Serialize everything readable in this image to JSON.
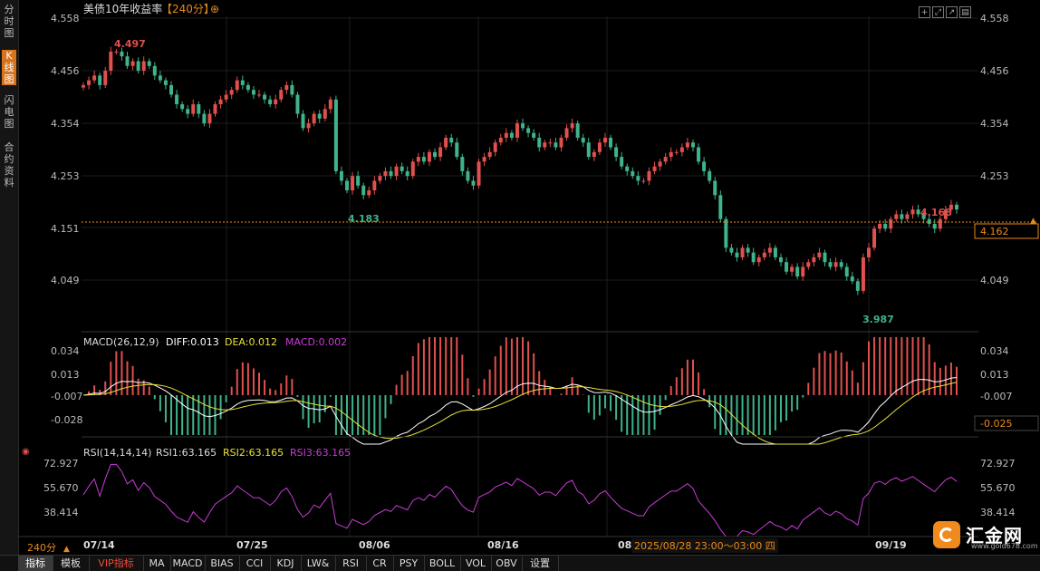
{
  "sidebar": {
    "tabs": [
      {
        "label": "分时图",
        "active": false
      },
      {
        "label": "K线图",
        "active": true
      },
      {
        "label": "闪电图",
        "active": false
      },
      {
        "label": "合约资料",
        "active": false
      }
    ]
  },
  "header": {
    "title": "美债10年收益率",
    "period": "【240分】",
    "add_icon": "circle-plus-icon",
    "tools": [
      "crosshair-icon",
      "expand-icon",
      "export-icon",
      "settings-icon"
    ]
  },
  "price_axis": {
    "labels": [
      "4.558",
      "4.456",
      "4.354",
      "4.253",
      "4.151",
      "4.049"
    ],
    "current_value": "4.162"
  },
  "annotations": {
    "high": "4.497",
    "low1": "4.183",
    "low2": "3.987",
    "recent_high": "4.168"
  },
  "macd": {
    "title": "MACD(26,12,9)",
    "diff": "DIFF:0.013",
    "dea": "DEA:0.012",
    "macd": "MACD:0.002",
    "axis_labels": [
      "0.034",
      "0.013",
      "-0.007",
      "-0.028"
    ],
    "current_value": "-0.025"
  },
  "rsi": {
    "title": "RSI(14,14,14)",
    "rsi1": "RSI1:63.165",
    "rsi2": "RSI2:63.165",
    "rsi3": "RSI3:63.165",
    "axis_labels": [
      "72.927",
      "55.670",
      "38.414"
    ]
  },
  "time_axis": {
    "period_label": "240分",
    "dates": [
      "07/14",
      "07/25",
      "08/06",
      "08/16",
      "08",
      "09/19"
    ],
    "crosshair_time": "2025/08/28 23:00～03:00 四"
  },
  "bottom_tabs": [
    "指标",
    "模板",
    "VIP指标",
    "MA",
    "MACD",
    "BIAS",
    "CCI",
    "KDJ",
    "LW&",
    "RSI",
    "CR",
    "PSY",
    "BOLL",
    "VOL",
    "OBV",
    "设置"
  ],
  "logo": {
    "text": "汇金网",
    "url": "www.gold678.com"
  },
  "colors": {
    "up": "#e0504d",
    "down": "#3fb389",
    "diff": "#ffffff",
    "dea": "#e8e13a",
    "rsi": "#c83cd6",
    "dashed": "#e88a1a",
    "accent": "#d8731c"
  },
  "chart_data": {
    "type": "candlestick",
    "title": "美债10年收益率",
    "ylim": [
      3.95,
      4.56
    ],
    "series": [
      {
        "name": "price",
        "values": [
          4.42,
          4.43,
          4.44,
          4.42,
          4.45,
          4.49,
          4.49,
          4.48,
          4.46,
          4.47,
          4.45,
          4.47,
          4.46,
          4.44,
          4.43,
          4.42,
          4.4,
          4.38,
          4.37,
          4.36,
          4.38,
          4.36,
          4.34,
          4.36,
          4.38,
          4.39,
          4.4,
          4.41,
          4.43,
          4.42,
          4.41,
          4.4,
          4.4,
          4.39,
          4.38,
          4.39,
          4.41,
          4.42,
          4.4,
          4.36,
          4.33,
          4.34,
          4.36,
          4.35,
          4.37,
          4.39,
          4.24,
          4.22,
          4.2,
          4.23,
          4.21,
          4.19,
          4.2,
          4.22,
          4.23,
          4.24,
          4.23,
          4.25,
          4.24,
          4.23,
          4.26,
          4.27,
          4.26,
          4.28,
          4.27,
          4.29,
          4.31,
          4.3,
          4.27,
          4.24,
          4.22,
          4.21,
          4.26,
          4.27,
          4.28,
          4.3,
          4.31,
          4.32,
          4.31,
          4.34,
          4.33,
          4.32,
          4.31,
          4.29,
          4.3,
          4.3,
          4.29,
          4.31,
          4.33,
          4.34,
          4.31,
          4.3,
          4.27,
          4.28,
          4.3,
          4.31,
          4.29,
          4.27,
          4.25,
          4.24,
          4.23,
          4.22,
          4.22,
          4.24,
          4.25,
          4.26,
          4.27,
          4.28,
          4.28,
          4.29,
          4.3,
          4.29,
          4.26,
          4.24,
          4.22,
          4.19,
          4.14,
          4.08,
          4.07,
          4.06,
          4.08,
          4.07,
          4.05,
          4.06,
          4.07,
          4.08,
          4.06,
          4.05,
          4.03,
          4.04,
          4.02,
          4.04,
          4.05,
          4.06,
          4.07,
          4.05,
          4.04,
          4.05,
          4.04,
          4.02,
          4.01,
          3.99,
          4.06,
          4.08,
          4.12,
          4.13,
          4.12,
          4.14,
          4.15,
          4.14,
          4.15,
          4.16,
          4.15,
          4.14,
          4.13,
          4.12,
          4.14,
          4.16,
          4.17,
          4.16
        ]
      }
    ]
  }
}
